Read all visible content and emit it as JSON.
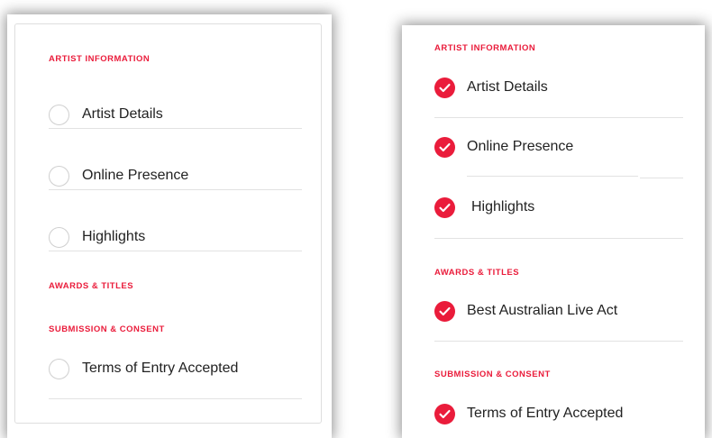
{
  "left_panel": {
    "sections": [
      {
        "title": "ARTIST INFORMATION",
        "items": [
          {
            "label": "Artist Details",
            "checked": false
          },
          {
            "label": "Online Presence",
            "checked": false
          },
          {
            "label": "Highlights",
            "checked": false
          }
        ]
      },
      {
        "title": "AWARDS & TITLES",
        "items": []
      },
      {
        "title": "SUBMISSION & CONSENT",
        "items": [
          {
            "label": "Terms of Entry Accepted",
            "checked": false
          }
        ]
      }
    ]
  },
  "right_panel": {
    "sections": [
      {
        "title": "ARTIST INFORMATION",
        "items": [
          {
            "label": "Artist Details",
            "checked": true
          },
          {
            "label": "Online Presence",
            "checked": true
          },
          {
            "label": "Highlights",
            "checked": true
          }
        ]
      },
      {
        "title": "AWARDS & TITLES",
        "items": [
          {
            "label": "Best Australian Live Act",
            "checked": true
          }
        ]
      },
      {
        "title": "SUBMISSION & CONSENT",
        "items": [
          {
            "label": "Terms of Entry Accepted",
            "checked": true
          }
        ]
      }
    ]
  },
  "colors": {
    "accent": "#ea1c3b",
    "divider": "#e2e2e2",
    "text": "#222222",
    "empty_check_border": "#cfcfcf"
  },
  "icons": {
    "unchecked": "empty-circle-icon",
    "checked": "red-checkmark-circle-icon"
  }
}
